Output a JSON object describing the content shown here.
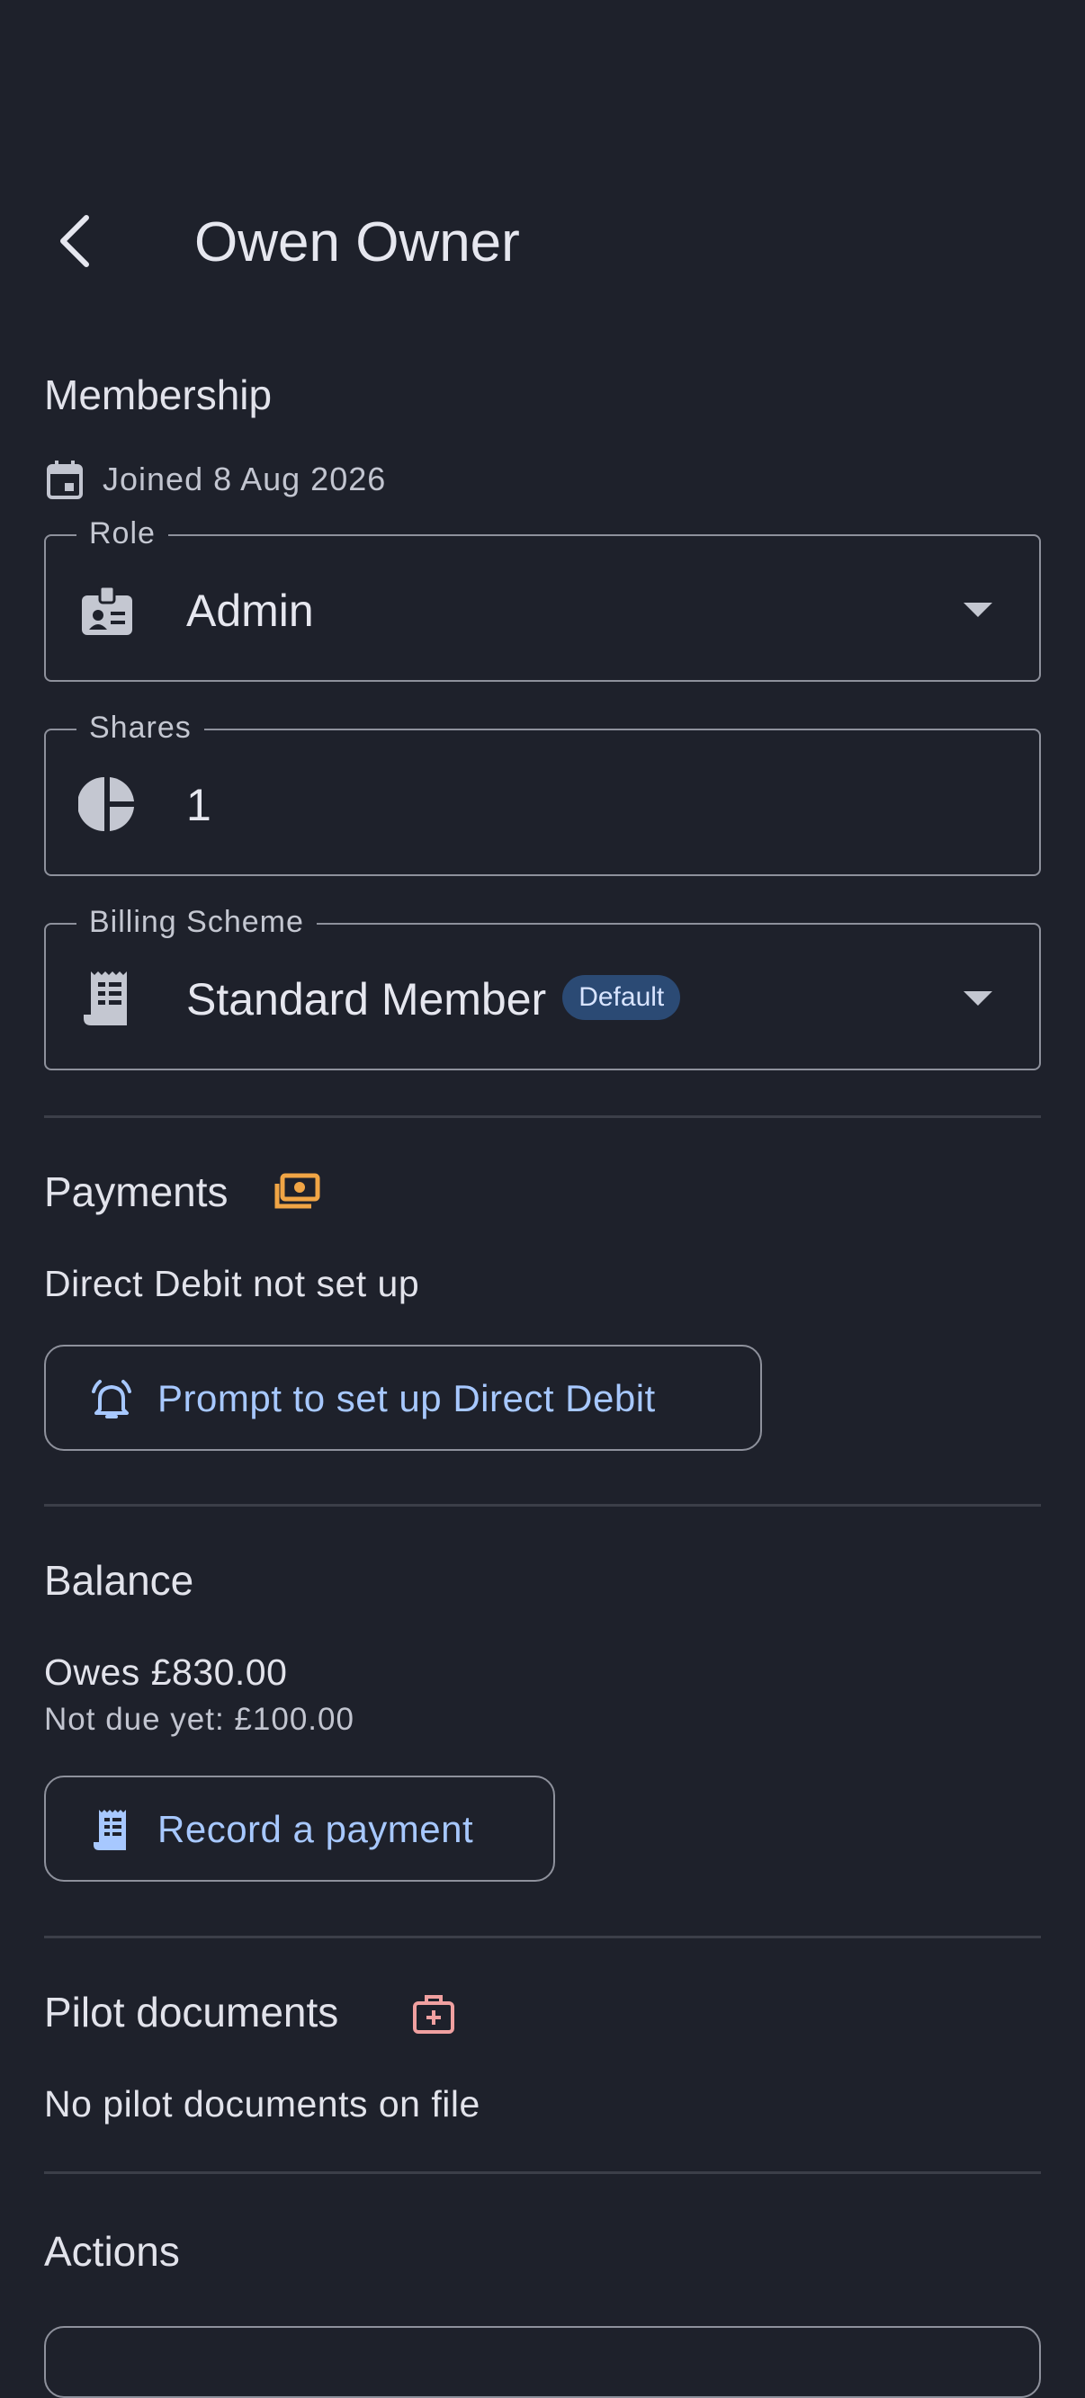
{
  "header": {
    "title": "Owen Owner"
  },
  "membership": {
    "heading": "Membership",
    "joined": "Joined 8 Aug 2026",
    "role": {
      "label": "Role",
      "value": "Admin"
    },
    "shares": {
      "label": "Shares",
      "value": "1"
    },
    "billing": {
      "label": "Billing Scheme",
      "value": "Standard Member",
      "badge": "Default"
    }
  },
  "payments": {
    "heading": "Payments",
    "status": "Direct Debit not set up",
    "button_label": "Prompt to set up Direct Debit"
  },
  "balance": {
    "heading": "Balance",
    "owes": "Owes £830.00",
    "not_due": "Not due yet: £100.00",
    "button_label": "Record a payment"
  },
  "pilot_documents": {
    "heading": "Pilot documents",
    "status": "No pilot documents on file"
  },
  "actions": {
    "heading": "Actions"
  },
  "colors": {
    "accent": "#a7c8ff",
    "payments_icon": "#f0a545",
    "documents_icon": "#f0a0a0"
  },
  "icons": [
    "back-arrow-icon",
    "calendar-icon",
    "badge-icon",
    "pie-chart-icon",
    "receipt-icon",
    "cash-icon",
    "alarm-bell-icon",
    "medical-bag-icon"
  ]
}
